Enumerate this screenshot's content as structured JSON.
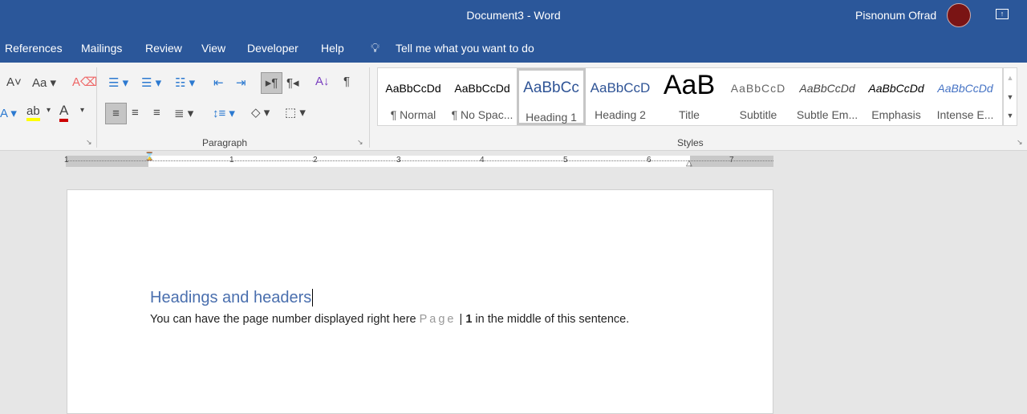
{
  "window": {
    "title": "Document3  -  Word",
    "user": "Pisnonum Ofrad"
  },
  "tabs": [
    "References",
    "Mailings",
    "Review",
    "View",
    "Developer",
    "Help"
  ],
  "tell_me": "Tell me what you want to do",
  "groups": {
    "paragraph": "Paragraph",
    "styles": "Styles"
  },
  "styles": [
    {
      "preview": "AaBbCcDd",
      "name": "¶ Normal"
    },
    {
      "preview": "AaBbCcDd",
      "name": "¶ No Spac..."
    },
    {
      "preview": "AaBbCc",
      "name": "Heading 1"
    },
    {
      "preview": "AaBbCcD",
      "name": "Heading 2"
    },
    {
      "preview": "AaB",
      "name": "Title"
    },
    {
      "preview": "AaBbCcD",
      "name": "Subtitle"
    },
    {
      "preview": "AaBbCcDd",
      "name": "Subtle Em..."
    },
    {
      "preview": "AaBbCcDd",
      "name": "Emphasis"
    },
    {
      "preview": "AaBbCcDd",
      "name": "Intense E..."
    }
  ],
  "ruler": [
    "1",
    "1",
    "2",
    "3",
    "4",
    "5",
    "6",
    "7"
  ],
  "document": {
    "heading": "Headings and headers",
    "body_before": "You can have the page number displayed right here ",
    "page_word": "Page",
    "separator": " | ",
    "page_number": "1",
    "body_after": " in the middle of this sentence."
  },
  "colors": {
    "brand": "#2b579a",
    "heading": "#4a6fae"
  }
}
